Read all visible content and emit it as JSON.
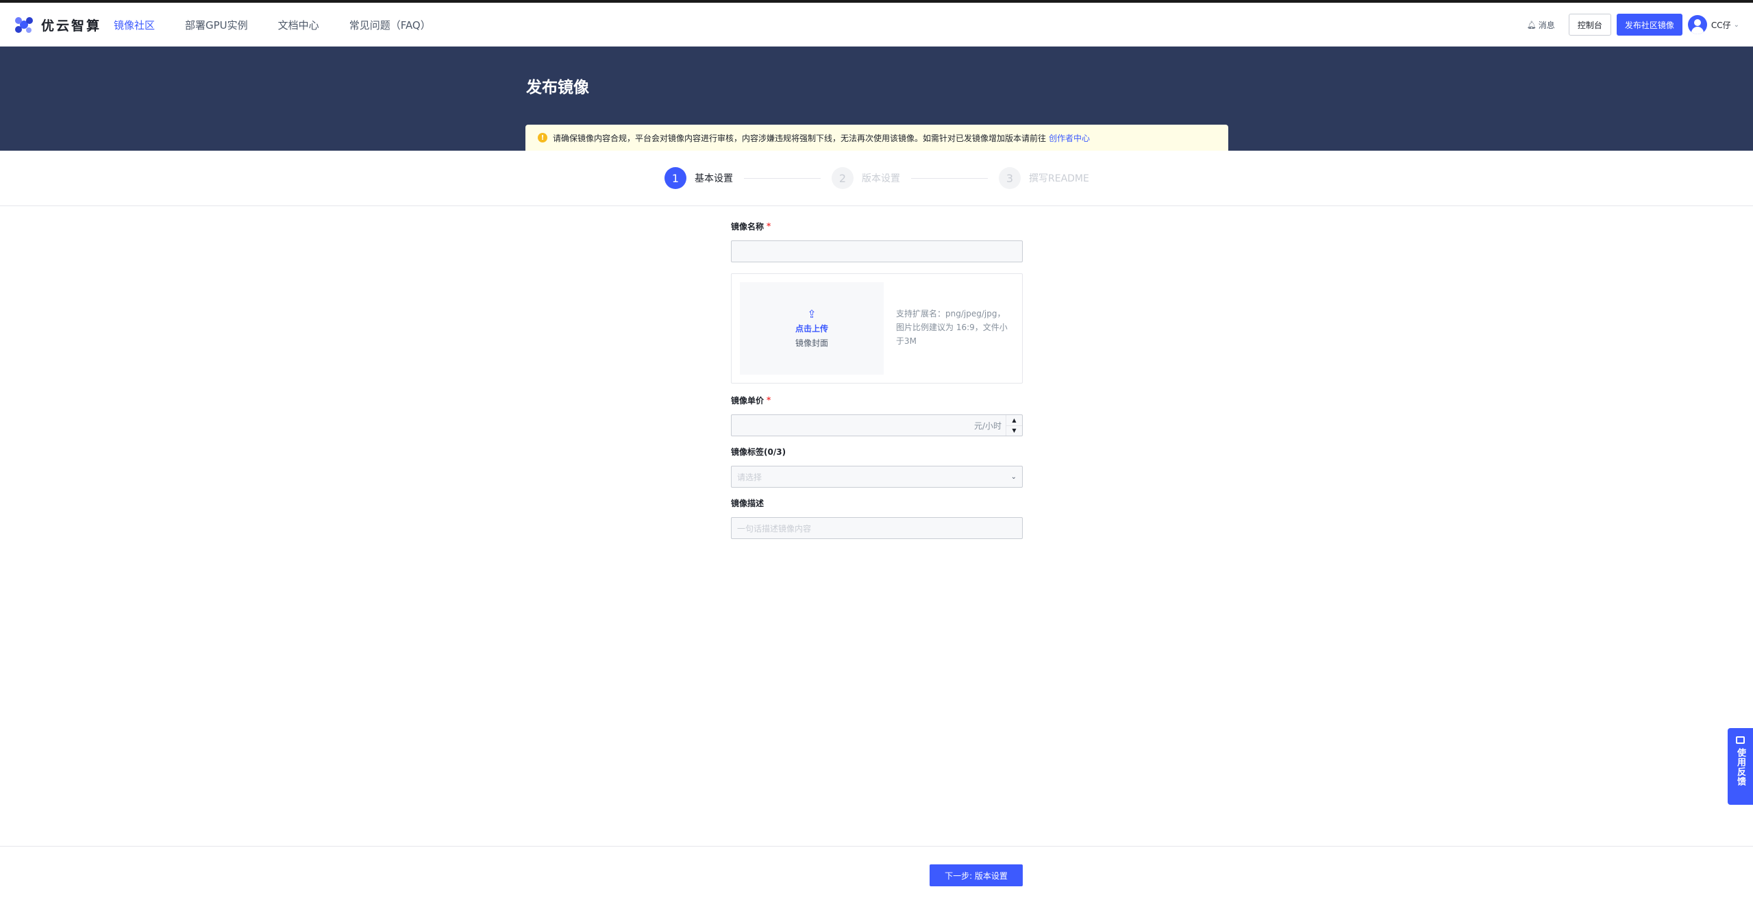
{
  "header": {
    "logo_text": "优云智算",
    "nav": [
      {
        "label": "镜像社区",
        "active": true
      },
      {
        "label": "部署GPU实例",
        "active": false
      },
      {
        "label": "文档中心",
        "active": false
      },
      {
        "label": "常见问题（FAQ）",
        "active": false
      }
    ],
    "messages_label": "消息",
    "console_label": "控制台",
    "publish_label": "发布社区镜像",
    "username": "CC仔"
  },
  "banner": {
    "title": "发布镜像",
    "notice_text": "请确保镜像内容合规，平台会对镜像内容进行审核，内容涉嫌违规将强制下线，无法再次使用该镜像。如需针对已发镜像增加版本请前往",
    "notice_link": "创作者中心"
  },
  "steps": [
    {
      "num": "1",
      "label": "基本设置",
      "active": true
    },
    {
      "num": "2",
      "label": "版本设置",
      "active": false
    },
    {
      "num": "3",
      "label": "撰写README",
      "active": false
    }
  ],
  "form": {
    "name_label": "镜像名称",
    "name_required": "*",
    "name_value": "",
    "upload_link": "点击上传",
    "upload_sub": "镜像封面",
    "upload_hint": "支持扩展名：png/jpeg/jpg，图片比例建议为 16:9，文件小于3M",
    "price_label": "镜像单价",
    "price_required": "*",
    "price_suffix": "元/小时",
    "tags_label": "镜像标签(0/3)",
    "tags_placeholder": "请选择",
    "desc_label": "镜像描述",
    "desc_placeholder": "一句话描述镜像内容"
  },
  "feedback_label": "使用反馈",
  "footer": {
    "next_label": "下一步: 版本设置"
  },
  "colors": {
    "accent": "#3d5afe",
    "banner": "#2d3a5c",
    "notice_bg": "#fffde6",
    "required": "#f53f3f"
  }
}
